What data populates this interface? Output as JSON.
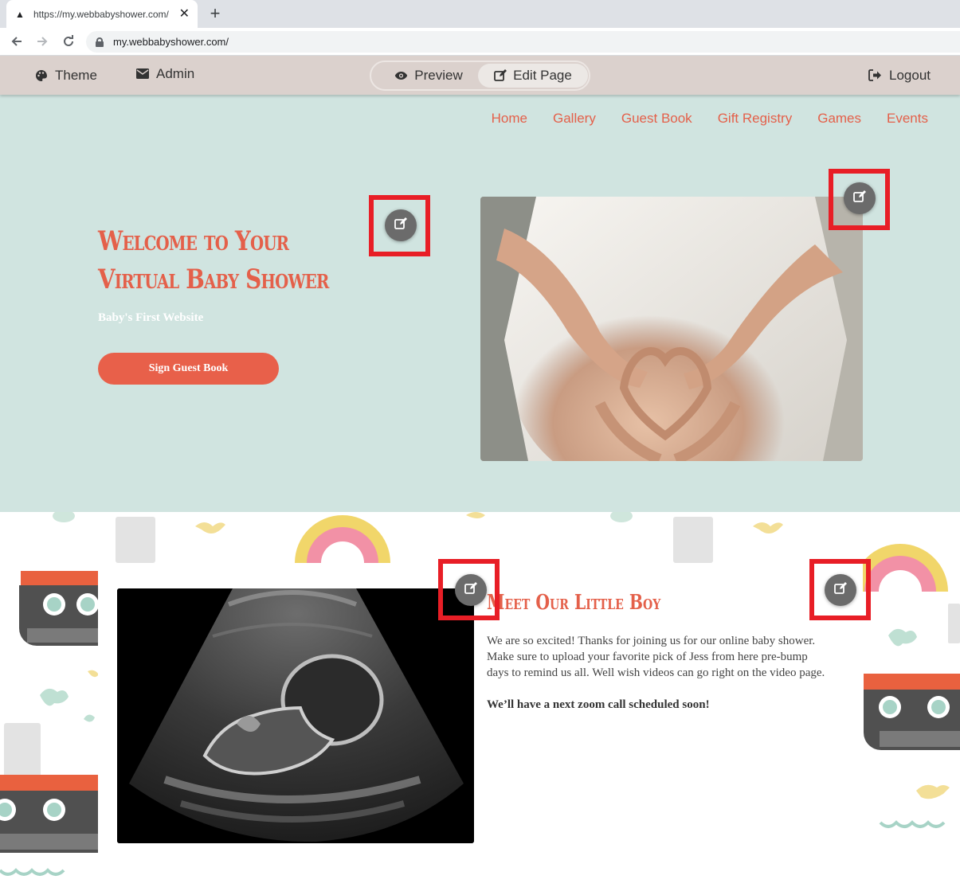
{
  "browser": {
    "tab_title": "https://my.webbabyshower.com/",
    "url": "my.webbabyshower.com/"
  },
  "editor_bar": {
    "theme_label": "Theme",
    "admin_label": "Admin",
    "preview_label": "Preview",
    "edit_page_label": "Edit Page",
    "logout_label": "Logout"
  },
  "site_nav": [
    "Home",
    "Gallery",
    "Guest Book",
    "Gift Registry",
    "Games",
    "Events"
  ],
  "hero": {
    "title": "Welcome to Your Virtual Baby Shower",
    "subtitle": "Baby's First Website",
    "button_label": "Sign Guest Book"
  },
  "intro": {
    "title": "Meet Our  Little Boy",
    "paragraph": "We are so excited! Thanks for joining us for our online baby shower.   Make sure to upload your favorite pick of Jess from here pre-bump days to remind us all. Well wish videos can go right on the video page.",
    "note": "We’ll have a next zoom call scheduled soon!"
  },
  "colors": {
    "accent": "#e4604a",
    "hero_bg": "#d0e4e0",
    "editor_bar_bg": "#dbd1cd",
    "highlight": "#e81e26"
  }
}
